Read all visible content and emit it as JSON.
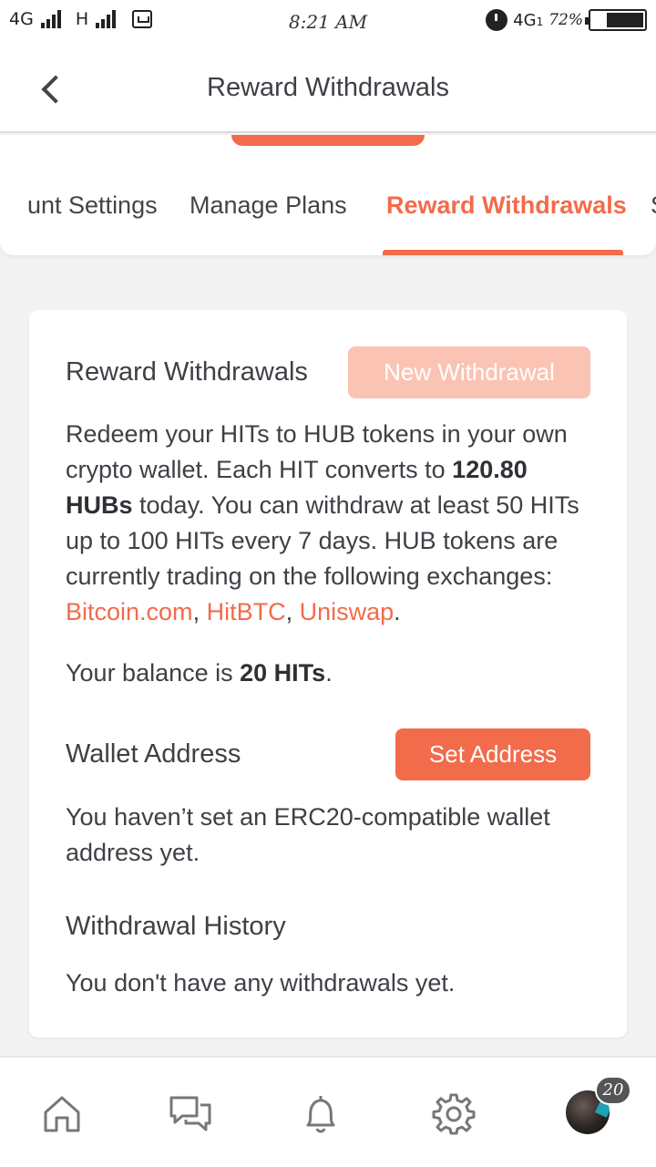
{
  "status_bar": {
    "network1": "4G",
    "network2": "H",
    "time": "8:21 AM",
    "network3": "4G",
    "network3_sub": "1",
    "battery": "72%"
  },
  "header": {
    "title": "Reward Withdrawals"
  },
  "tabs": [
    {
      "label": "unt Settings",
      "active": false
    },
    {
      "label": "Manage Plans",
      "active": false
    },
    {
      "label": "Reward Withdrawals",
      "active": true
    },
    {
      "label": "S",
      "active": false
    }
  ],
  "rewards": {
    "title": "Reward Withdrawals",
    "new_button": "New Withdrawal",
    "desc_part1": "Redeem your HITs to HUB tokens in your own crypto wallet. Each HIT converts to ",
    "rate": "120.80 HUBs",
    "desc_part2": " today. You can withdraw at least 50 HITs up to 100 HITs every 7 days. HUB tokens are currently trading on the following exchanges: ",
    "exchange1": "Bitcoin.com",
    "exchange2": "HitBTC",
    "exchange3": "Uniswap",
    "sep": ", ",
    "end": ".",
    "balance_prefix": "Your balance is ",
    "balance_value": "20 HITs",
    "balance_suffix": "."
  },
  "wallet": {
    "title": "Wallet Address",
    "set_button": "Set Address",
    "message": "You haven’t set an ERC20-compatible wallet address yet."
  },
  "history": {
    "title": "Withdrawal History",
    "message": "You don't have any withdrawals yet."
  },
  "bottom_nav": {
    "items": [
      "home-icon",
      "chat-icon",
      "bell-icon",
      "gear-icon",
      "avatar"
    ],
    "badge": "20"
  },
  "colors": {
    "accent": "#f26b4b",
    "accent_light": "#fbc3b3"
  }
}
